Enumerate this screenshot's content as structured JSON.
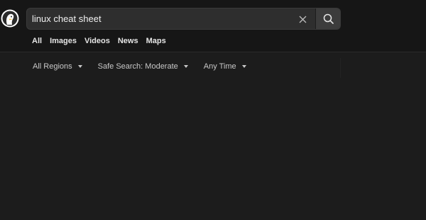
{
  "search": {
    "value": "linux cheat sheet",
    "clear_icon": "close-icon",
    "submit_icon": "search-icon"
  },
  "logo": {
    "icon": "duck-logo-icon"
  },
  "tabs": [
    {
      "label": "All"
    },
    {
      "label": "Images"
    },
    {
      "label": "Videos"
    },
    {
      "label": "News"
    },
    {
      "label": "Maps"
    }
  ],
  "filters": [
    {
      "label": "All Regions"
    },
    {
      "label": "Safe Search: Moderate"
    },
    {
      "label": "Any Time"
    }
  ],
  "colors": {
    "background": "#1c1c1c",
    "header": "#161616",
    "search_box": "#2e2e2e"
  }
}
